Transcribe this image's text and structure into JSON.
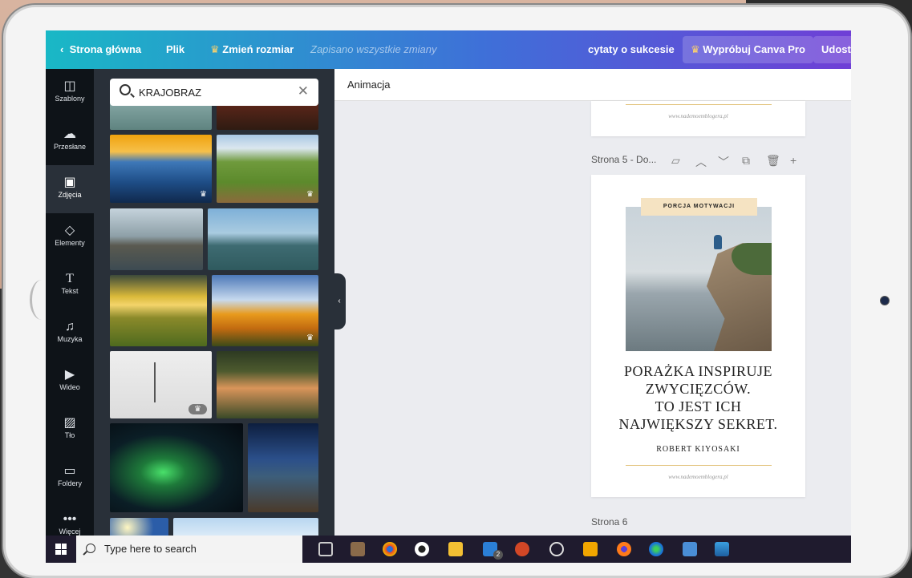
{
  "topbar": {
    "back_label": "Strona główna",
    "file_label": "Plik",
    "resize_label": "Zmień rozmiar",
    "saved_status": "Zapisano wszystkie zmiany",
    "project_title": "cytaty o sukcesie",
    "try_pro_label": "Wypróbuj Canva Pro",
    "share_label": "Udoste"
  },
  "sidebar": {
    "items": [
      {
        "label": "Szablony",
        "icon": "template-icon"
      },
      {
        "label": "Przesłane",
        "icon": "upload-cloud-icon"
      },
      {
        "label": "Zdjęcia",
        "icon": "image-icon"
      },
      {
        "label": "Elementy",
        "icon": "shapes-icon"
      },
      {
        "label": "Tekst",
        "icon": "text-icon"
      },
      {
        "label": "Muzyka",
        "icon": "music-icon"
      },
      {
        "label": "Wideo",
        "icon": "video-icon"
      },
      {
        "label": "Tło",
        "icon": "background-icon"
      },
      {
        "label": "Foldery",
        "icon": "folder-icon"
      },
      {
        "label": "Więcej",
        "icon": "more-icon"
      }
    ],
    "active": "Zdjęcia"
  },
  "search": {
    "value": "KRAJOBRAZ"
  },
  "photos": [
    {
      "subject": "lake mist",
      "premium": false
    },
    {
      "subject": "autumn forest",
      "premium": false
    },
    {
      "subject": "blue mountains at sunset",
      "premium": true
    },
    {
      "subject": "green valley path",
      "premium": true
    },
    {
      "subject": "wooden boardwalk",
      "premium": false
    },
    {
      "subject": "mountain range",
      "premium": false
    },
    {
      "subject": "golden sunset field",
      "premium": false
    },
    {
      "subject": "flower field under clouds",
      "premium": true
    },
    {
      "subject": "lonely tree in snow",
      "premium": true
    },
    {
      "subject": "forest lake at dusk",
      "premium": false
    },
    {
      "subject": "northern lights",
      "premium": false
    },
    {
      "subject": "starry sky over mountain",
      "premium": false
    }
  ],
  "canvas": {
    "toolbar_label": "Animacja",
    "page5_label": "Strona 5 - Do...",
    "page6_label": "Strona 6",
    "website": "www.nademoemblogera.pl",
    "tag": "PORCJA MOTYWACJI",
    "quote_lines": [
      "PORAŻKA INSPIRUJE",
      "ZWYCIĘZCÓW.",
      "TO JEST ICH",
      "NAJWIĘKSZY SEKRET."
    ],
    "author": "ROBERT KIYOSAKI"
  },
  "taskbar": {
    "search_placeholder": "Type here to search",
    "mail_badge": "2"
  },
  "colors": {
    "gradient_start": "#19b8c6",
    "gradient_end": "#6f3fd6",
    "panel": "#293039",
    "rail": "#0e1318",
    "gold": "#e2c27a"
  }
}
